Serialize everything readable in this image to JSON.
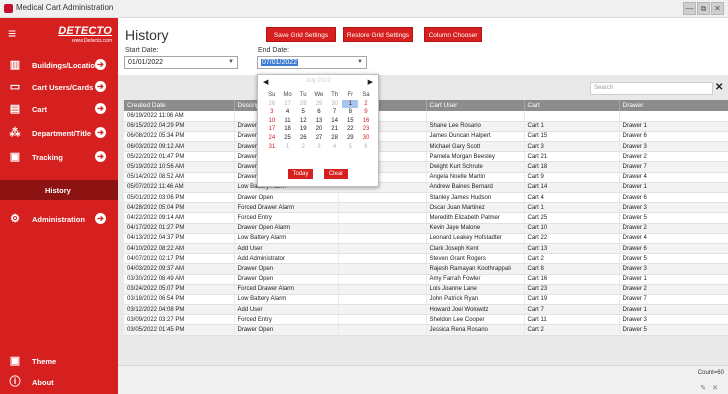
{
  "window": {
    "title": "Medical Cart Administration",
    "controls": [
      "—",
      "⧉",
      "✕"
    ]
  },
  "logo": {
    "brand": "DETECTO",
    "url": "www.Detecto.com"
  },
  "sidebar": {
    "items": [
      {
        "label": "Buildings/Locations",
        "icon": "building-icon"
      },
      {
        "label": "Cart Users/Cards",
        "icon": "card-icon"
      },
      {
        "label": "Cart",
        "icon": "cart-icon"
      },
      {
        "label": "Department/Title",
        "icon": "department-icon"
      },
      {
        "label": "Tracking",
        "icon": "tracking-icon"
      },
      {
        "label": "Administration",
        "icon": "gear-icon"
      },
      {
        "label": "Theme",
        "icon": "theme-icon"
      },
      {
        "label": "About",
        "icon": "info-icon"
      }
    ],
    "active_sub": "History"
  },
  "page": {
    "title": "History",
    "buttons": {
      "save": "Save Grid Settings",
      "restore": "Restore Grid Settings",
      "chooser": "Column Chooser"
    },
    "start_label": "Start Date:",
    "start_value": "01/01/2022",
    "end_label": "End Date:",
    "end_value": "07/01/2022",
    "search_placeholder": "Search"
  },
  "calendar": {
    "month_year": "July 2022",
    "day_headers": [
      "Su",
      "Mo",
      "Tu",
      "We",
      "Th",
      "Fr",
      "Sa"
    ],
    "weeks": [
      [
        "26",
        "27",
        "28",
        "29",
        "30",
        "1",
        "2"
      ],
      [
        "3",
        "4",
        "5",
        "6",
        "7",
        "8",
        "9"
      ],
      [
        "10",
        "11",
        "12",
        "13",
        "14",
        "15",
        "16"
      ],
      [
        "17",
        "18",
        "19",
        "20",
        "21",
        "22",
        "23"
      ],
      [
        "24",
        "25",
        "26",
        "27",
        "28",
        "29",
        "30"
      ],
      [
        "31",
        "1",
        "2",
        "3",
        "4",
        "5",
        "6"
      ]
    ],
    "selected": "1",
    "today_label": "Today",
    "clear_label": "Clear"
  },
  "grid": {
    "headers": [
      "Created Date",
      "Description",
      "",
      "Cart User",
      "Cart",
      "Drawer"
    ],
    "rows": [
      [
        "06/19/2022 11:06 AM",
        "",
        "",
        "",
        "",
        ""
      ],
      [
        "06/15/2022 04:29 PM",
        "Drawer Open",
        "",
        "Shane Lee Rosario",
        "Cart 1",
        "Drawer 1"
      ],
      [
        "06/08/2022 05:34 PM",
        "Drawer Open",
        "",
        "James Duncan Halpert",
        "Cart 15",
        "Drawer 6"
      ],
      [
        "06/03/2022 09:12 AM",
        "Drawer Open",
        "",
        "Michael Gary Scott",
        "Cart 3",
        "Drawer 3"
      ],
      [
        "05/22/2022 01:47 PM",
        "Drawer Open",
        "",
        "Pamela Morgan Beesley",
        "Cart 21",
        "Drawer 2"
      ],
      [
        "05/19/2022 10:56 AM",
        "Drawer Open",
        "",
        "Dwight Kurt Schrute",
        "Cart 18",
        "Drawer 7"
      ],
      [
        "05/14/2022 08:52 AM",
        "Drawer Open",
        "",
        "Angela Noelle Martin",
        "Cart 9",
        "Drawer 4"
      ],
      [
        "05/07/2022 11:46 AM",
        "Low Battery Alarm",
        "",
        "Andrew Baines Bernard",
        "Cart 14",
        "Drawer 1"
      ],
      [
        "05/01/2022 03:06 PM",
        "Drawer Open",
        "",
        "Stanley James Hudson",
        "Cart 4",
        "Drawer 6"
      ],
      [
        "04/28/2022 05:04 PM",
        "Forced Drawer Alarm",
        "",
        "Oscar Juan Martinez",
        "Cart 1",
        "Drawer 3"
      ],
      [
        "04/22/2022 09:14 AM",
        "Forced Entry",
        "",
        "Meredith Elizabeth Palmer",
        "Cart 25",
        "Drawer 5"
      ],
      [
        "04/17/2022 01:27 PM",
        "Drawer Open Alarm",
        "",
        "Kevin Jaye Malone",
        "Cart 10",
        "Drawer 2"
      ],
      [
        "04/13/2022 04:37 PM",
        "Low Battery Alarm",
        "",
        "Leonard Leakey Hofstadter",
        "Cart 22",
        "Drawer 4"
      ],
      [
        "04/10/2022 08:22 AM",
        "Add User",
        "",
        "Clark Joseph Kent",
        "Cart 13",
        "Drawer 6"
      ],
      [
        "04/07/2022 02:17 PM",
        "Add Administrator",
        "",
        "Steven Grant Rogers",
        "Cart 2",
        "Drawer 5"
      ],
      [
        "04/03/2022 09:37 AM",
        "Drawer Open",
        "",
        "Rajesh Ramayan Koothrappali",
        "Cart 8",
        "Drawer 3"
      ],
      [
        "03/30/2022 08:49 AM",
        "Drawer Open",
        "",
        "Amy Farrah Fowler",
        "Cart 16",
        "Drawer 1"
      ],
      [
        "03/24/2022 05:07 PM",
        "Forced Drawer Alarm",
        "",
        "Lois Joanne Lane",
        "Cart 23",
        "Drawer 2"
      ],
      [
        "03/18/2022 06:54 PM",
        "Low Battery Alarm",
        "",
        "John Patrick Ryan",
        "Cart 19",
        "Drawer 7"
      ],
      [
        "03/12/2022 04:08 PM",
        "Add User",
        "",
        "Howard Joel Wolowitz",
        "Cart 7",
        "Drawer 1"
      ],
      [
        "03/09/2022 03:27 PM",
        "Forced Entry",
        "",
        "Sheldon Lee Cooper",
        "Cart 11",
        "Drawer 3"
      ],
      [
        "03/05/2022 01:45 PM",
        "Drawer Open",
        "",
        "Jessica Rena Rosario",
        "Cart 2",
        "Drawer 5"
      ]
    ]
  },
  "footer": {
    "count": "Count=60"
  }
}
